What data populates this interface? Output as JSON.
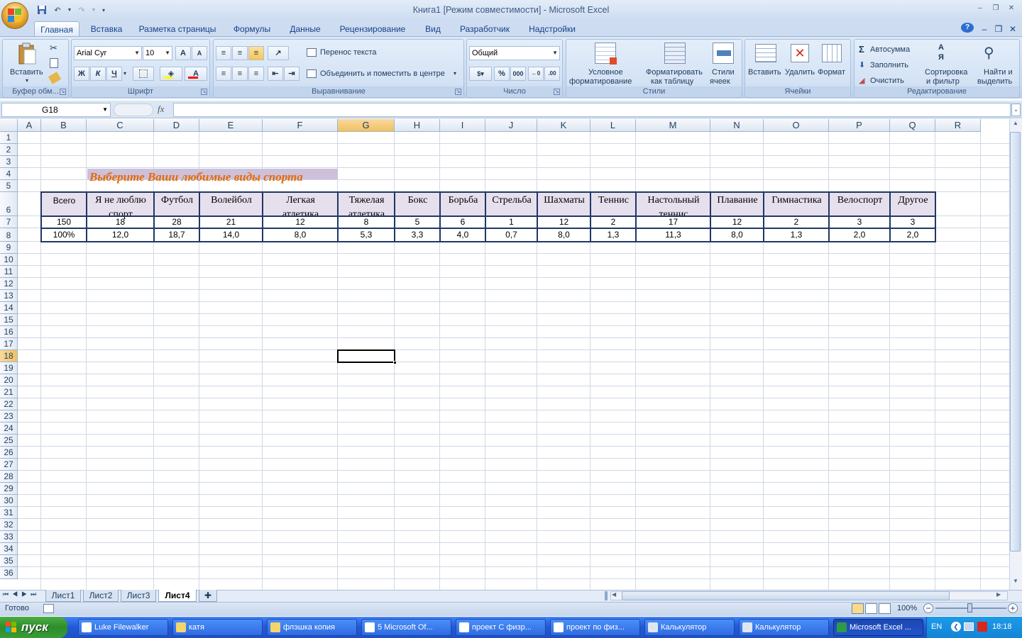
{
  "window": {
    "title": "Книга1  [Режим совместимости] - Microsoft Excel",
    "controls": [
      "–",
      "❐",
      "✕"
    ],
    "doc_controls": [
      "–",
      "❐",
      "✕"
    ]
  },
  "ribbon_tabs": [
    "Главная",
    "Вставка",
    "Разметка страницы",
    "Формулы",
    "Данные",
    "Рецензирование",
    "Вид",
    "Разработчик",
    "Надстройки"
  ],
  "clipboard": {
    "paste": "Вставить",
    "label": "Буфер обм..."
  },
  "font": {
    "name": "Arial Cyr",
    "size": "10",
    "bold": "Ж",
    "italic": "К",
    "underline": "Ч",
    "grow": "A",
    "shrink": "A",
    "color_letter": "A",
    "label": "Шрифт"
  },
  "alignment": {
    "wrap": "Перенос текста",
    "merge": "Объединить и поместить в центре",
    "label": "Выравнивание"
  },
  "number": {
    "format": "Общий",
    "percent": "%",
    "thousands": "000",
    "label": "Число"
  },
  "styles": {
    "conditional": [
      "Условное",
      "форматирование"
    ],
    "as_table": [
      "Форматировать",
      "как таблицу"
    ],
    "cell_styles": [
      "Стили",
      "ячеек"
    ],
    "label": "Стили"
  },
  "cells": {
    "insert": "Вставить",
    "delete": "Удалить",
    "format": "Формат",
    "label": "Ячейки"
  },
  "editing": {
    "autosum": "Автосумма",
    "fill": "Заполнить",
    "clear": "Очистить",
    "sort": [
      "Сортировка",
      "и фильтр"
    ],
    "find": [
      "Найти и",
      "выделить"
    ],
    "label": "Редактирование"
  },
  "formula_bar": {
    "name_box": "G18",
    "fx": "fx",
    "value": ""
  },
  "columns": [
    "A",
    "B",
    "C",
    "D",
    "E",
    "F",
    "G",
    "H",
    "I",
    "J",
    "K",
    "L",
    "M",
    "N",
    "O",
    "P",
    "Q",
    "R"
  ],
  "rows": [
    "1",
    "2",
    "3",
    "4",
    "5",
    "6",
    "7",
    "8",
    "9",
    "10",
    "11",
    "12",
    "13",
    "14",
    "15",
    "16",
    "17",
    "18",
    "19",
    "20",
    "21",
    "22",
    "23",
    "24",
    "25",
    "26",
    "27",
    "28",
    "29",
    "30",
    "31",
    "32",
    "33",
    "34",
    "35",
    "36"
  ],
  "sheet": {
    "heading": "Выберите Ваши любимые виды спорта",
    "total_label": "Всего",
    "categories": [
      [
        "Я не люблю",
        "спорт"
      ],
      [
        "Футбол"
      ],
      [
        "Волейбол"
      ],
      [
        "Легкая",
        "атлетика"
      ],
      [
        "Тяжелая",
        "атлетика"
      ],
      [
        "Бокс"
      ],
      [
        "Борьба"
      ],
      [
        "Стрельба"
      ],
      [
        "Шахматы"
      ],
      [
        "Теннис"
      ],
      [
        "Настольный",
        "теннис"
      ],
      [
        "Плавание"
      ],
      [
        "Гимнастика"
      ],
      [
        "Велоспорт"
      ],
      [
        "Другое"
      ]
    ],
    "counts": [
      "150",
      "18",
      "28",
      "21",
      "12",
      "8",
      "5",
      "6",
      "1",
      "12",
      "2",
      "17",
      "12",
      "2",
      "3",
      "3"
    ],
    "percents": [
      "100%",
      "12,0",
      "18,7",
      "14,0",
      "8,0",
      "5,3",
      "3,3",
      "4,0",
      "0,7",
      "8,0",
      "1,3",
      "11,3",
      "8,0",
      "1,3",
      "2,0",
      "2,0"
    ]
  },
  "sheet_tabs": [
    "Лист1",
    "Лист2",
    "Лист3",
    "Лист4"
  ],
  "active_sheet": "Лист4",
  "status": {
    "ready": "Готово",
    "zoom": "100%"
  },
  "taskbar": {
    "start": "пуск",
    "items": [
      "Luke Filewalker",
      "катя",
      "флэшка копия",
      "5 Microsoft Of...",
      "проект С физр...",
      "проект по физ...",
      "Калькулятор",
      "Калькулятор",
      "Microsoft Excel ..."
    ],
    "lang": "EN",
    "clock": "18:18"
  }
}
